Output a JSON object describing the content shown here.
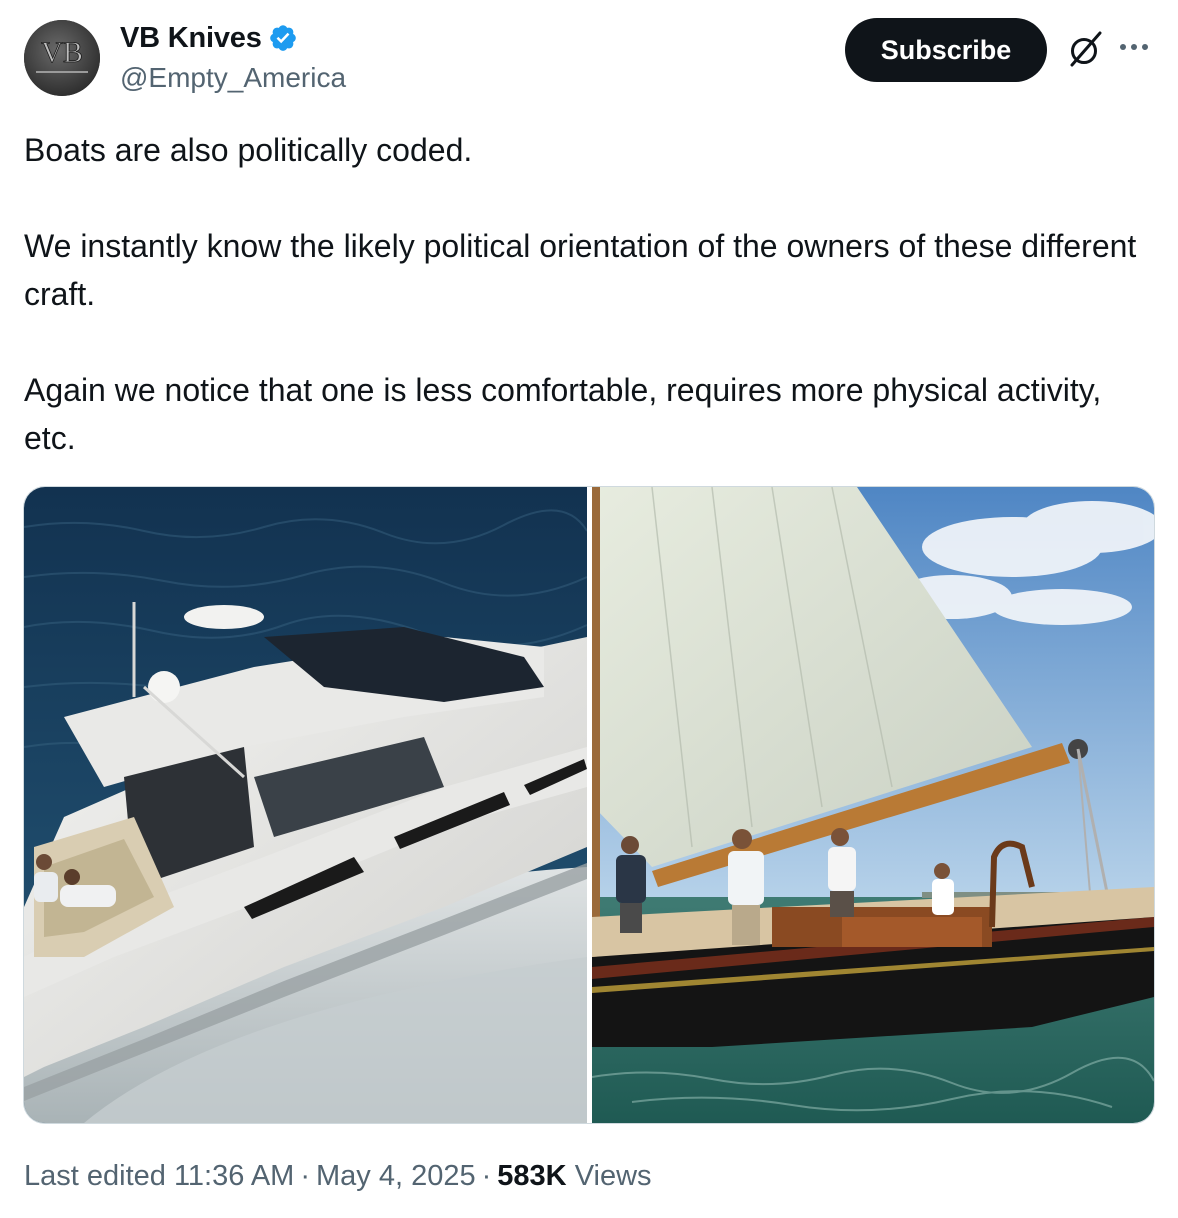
{
  "author": {
    "display_name": "VB Knives",
    "handle": "@Empty_America",
    "avatar_text": "VB",
    "verified": true
  },
  "actions": {
    "subscribe_label": "Subscribe"
  },
  "tweet": {
    "paragraphs": [
      "Boats are also politically coded.",
      "We instantly know the likely political orientation of the owners of these different craft.",
      "Again we notice that one is less comfortable, requires more physical activity, etc."
    ]
  },
  "media": {
    "images": [
      "motor-yacht-photo",
      "sailboat-photo"
    ]
  },
  "meta": {
    "edited_prefix": "Last edited",
    "time": "11:36 AM",
    "date": "May 4, 2025",
    "separator": "·",
    "views_count": "583K",
    "views_label": "Views"
  },
  "colors": {
    "text": "#0f1419",
    "secondary": "#536471",
    "verified": "#1d9bf0",
    "button_bg": "#0f1419",
    "border": "#cfd9de"
  }
}
